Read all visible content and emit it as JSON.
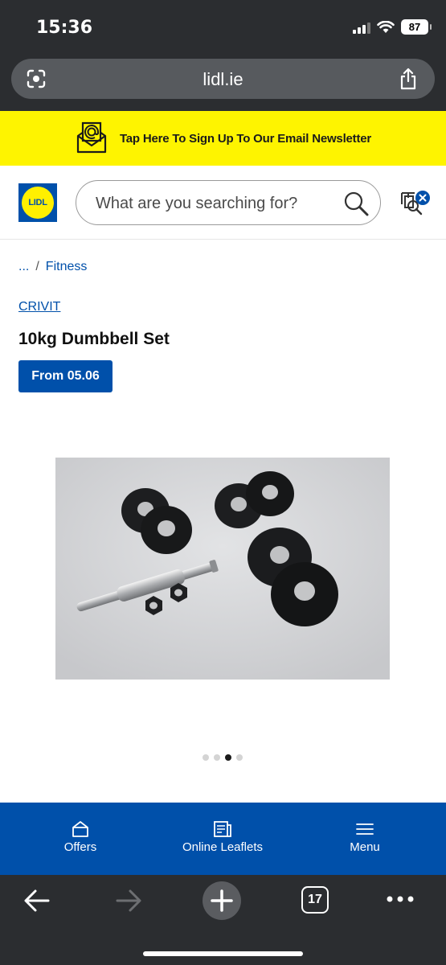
{
  "status_bar": {
    "time": "15:36",
    "battery": "87"
  },
  "browser": {
    "url": "lidl.ie",
    "tab_count": "17"
  },
  "newsletter": {
    "text": "Tap Here To Sign Up To Our Email Newsletter"
  },
  "header": {
    "logo_text": "LIDL",
    "search_placeholder": "What are you searching for?"
  },
  "breadcrumb": {
    "ellipsis": "...",
    "separator": "/",
    "current": "Fitness"
  },
  "product": {
    "brand": "CRIVIT",
    "title": "10kg Dumbbell Set",
    "availability": "From 05.06"
  },
  "carousel": {
    "total": 4,
    "active_index": 2
  },
  "bottom_nav": [
    {
      "label": "Offers",
      "icon": "offers-icon"
    },
    {
      "label": "Online Leaflets",
      "icon": "leaflet-icon"
    },
    {
      "label": "Menu",
      "icon": "menu-icon"
    }
  ],
  "colors": {
    "lidl_blue": "#0050aa",
    "lidl_yellow": "#fff000",
    "newsletter_bg": "#fef400"
  }
}
